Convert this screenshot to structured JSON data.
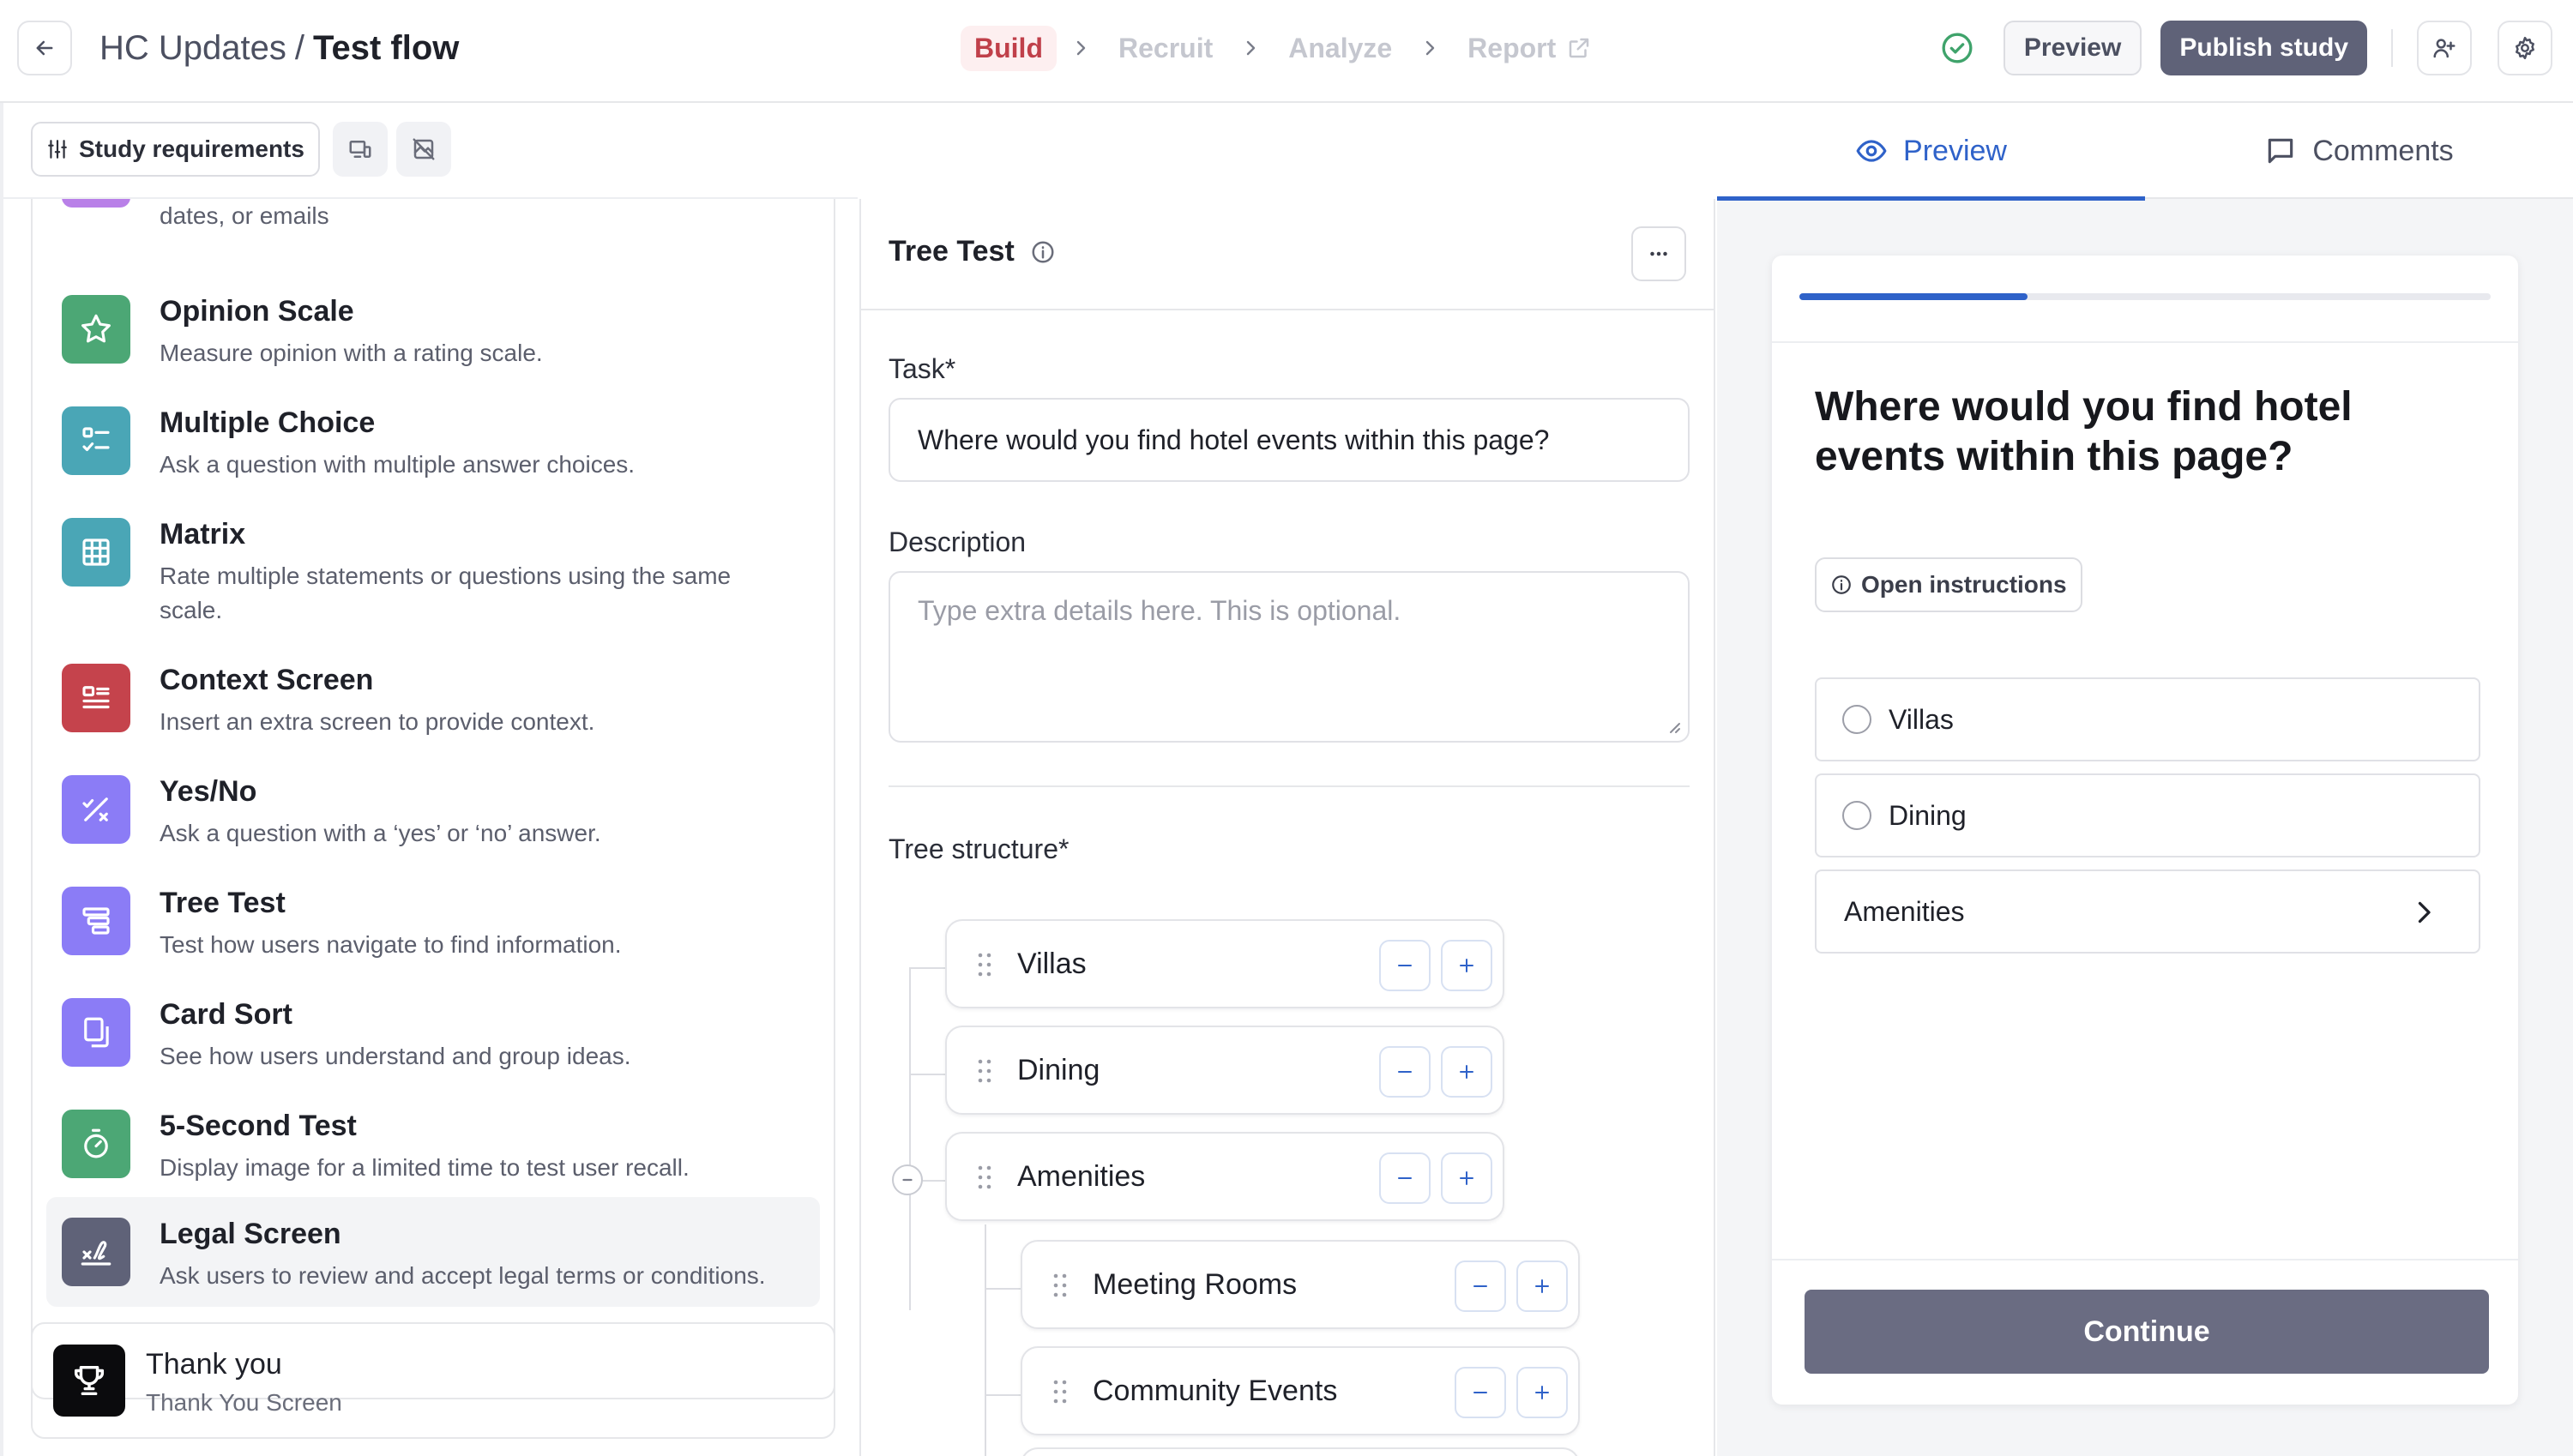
{
  "header": {
    "project": "HC Updates",
    "separator": "/",
    "flow": "Test flow",
    "steps": [
      {
        "label": "Build",
        "active": true
      },
      {
        "label": "Recruit",
        "active": false
      },
      {
        "label": "Analyze",
        "active": false
      },
      {
        "label": "Report",
        "active": false,
        "external": true
      }
    ],
    "preview_label": "Preview",
    "publish_label": "Publish study"
  },
  "left": {
    "requirements_label": "Study requirements",
    "partial_desc": "dates, or emails",
    "blocks": [
      {
        "title": "Opinion Scale",
        "desc": "Measure opinion with a rating scale.",
        "icon": "star-icon",
        "color": "#4ca775"
      },
      {
        "title": "Multiple Choice",
        "desc": "Ask a question with multiple answer choices.",
        "icon": "checklist-icon",
        "color": "#4aa6b6"
      },
      {
        "title": "Matrix",
        "desc": "Rate multiple statements or questions using the same scale.",
        "icon": "grid-icon",
        "color": "#4aa6b6"
      },
      {
        "title": "Context Screen",
        "desc": "Insert an extra screen to provide context.",
        "icon": "article-icon",
        "color": "#c5434c"
      },
      {
        "title": "Yes/No",
        "desc": "Ask a question with a ‘yes’ or ‘no’ answer.",
        "icon": "yes-no-icon",
        "color": "#8b7cf6"
      },
      {
        "title": "Tree Test",
        "desc": "Test how users navigate to find information.",
        "icon": "tree-icon",
        "color": "#8b7cf6"
      },
      {
        "title": "Card Sort",
        "desc": "See how users understand and group ideas.",
        "icon": "cards-icon",
        "color": "#8b7cf6"
      },
      {
        "title": "5-Second Test",
        "desc": "Display image for a limited time to test user recall.",
        "icon": "timer-icon",
        "color": "#4ca775"
      },
      {
        "title": "Legal Screen",
        "desc": "Ask users to review and accept legal terms or conditions.",
        "icon": "signature-icon",
        "color": "#5f6278"
      }
    ],
    "thanks_title": "Thank you",
    "thanks_sub": "Thank You Screen"
  },
  "editor": {
    "title": "Tree Test",
    "task_label": "Task*",
    "task_value": "Where would you find hotel events within this page?",
    "description_label": "Description",
    "description_placeholder": "Type extra details here. This is optional.",
    "tree_label": "Tree structure*",
    "tree": [
      {
        "label": "Villas",
        "level": 0
      },
      {
        "label": "Dining",
        "level": 0
      },
      {
        "label": "Amenities",
        "level": 0
      },
      {
        "label": "Meeting Rooms",
        "level": 1
      },
      {
        "label": "Community Events",
        "level": 1
      }
    ]
  },
  "preview": {
    "tabs": [
      {
        "label": "Preview",
        "active": true
      },
      {
        "label": "Comments",
        "active": false
      }
    ],
    "progress": 0.33,
    "question": "Where would you find hotel events within this page?",
    "instructions_label": "Open instructions",
    "options": [
      {
        "label": "Villas",
        "type": "radio"
      },
      {
        "label": "Dining",
        "type": "radio"
      },
      {
        "label": "Amenities",
        "type": "expand"
      }
    ],
    "continue_label": "Continue"
  },
  "colors": {
    "accent": "#2f62c9",
    "build_active": "#c0404a",
    "publish_bg": "#5f6278",
    "continue_bg": "#6a6c82"
  }
}
